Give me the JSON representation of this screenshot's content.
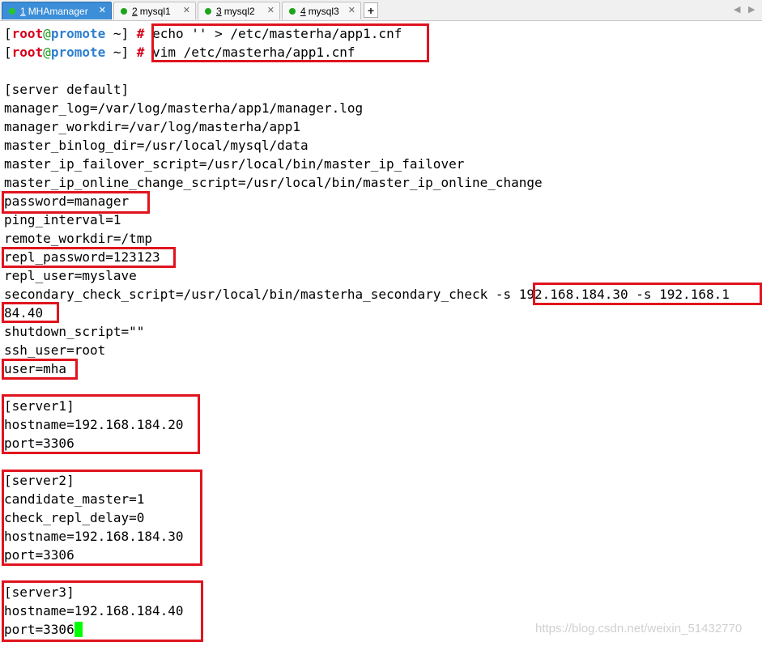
{
  "tabs": [
    {
      "num": "1",
      "label": "MHAmanager",
      "close": "✕"
    },
    {
      "num": "2",
      "label": "mysql1",
      "close": "✕"
    },
    {
      "num": "3",
      "label": "mysql2",
      "close": "✕"
    },
    {
      "num": "4",
      "label": "mysql3",
      "close": "✕"
    }
  ],
  "add_tab": "+",
  "nav": {
    "left": "◀",
    "right": "▶"
  },
  "prompt": {
    "open": "[",
    "user": "root",
    "at": "@",
    "host": "promote",
    "path": " ~]",
    "hash": "#"
  },
  "commands": [
    "echo '' > /etc/masterha/app1.cnf",
    "vim /etc/masterha/app1.cnf"
  ],
  "file_lines": [
    "[server default]",
    "manager_log=/var/log/masterha/app1/manager.log",
    "manager_workdir=/var/log/masterha/app1",
    "master_binlog_dir=/usr/local/mysql/data",
    "master_ip_failover_script=/usr/local/bin/master_ip_failover",
    "master_ip_online_change_script=/usr/local/bin/master_ip_online_change",
    "password=manager",
    "ping_interval=1",
    "remote_workdir=/tmp",
    "repl_password=123123",
    "repl_user=myslave",
    "secondary_check_script=/usr/local/bin/masterha_secondary_check -s 192.168.184.30 -s 192.168.1",
    "84.40",
    "shutdown_script=\"\"",
    "ssh_user=root",
    "user=mha",
    "",
    "[server1]",
    "hostname=192.168.184.20",
    "port=3306",
    "",
    "[server2]",
    "candidate_master=1",
    "check_repl_delay=0",
    "hostname=192.168.184.30",
    "port=3306",
    "",
    "[server3]",
    "hostname=192.168.184.40",
    "port=3306"
  ],
  "watermark": "https://blog.csdn.net/weixin_51432770",
  "colors": {
    "highlight": "#e0141e",
    "cursor": "#00ff00",
    "active_tab": "#3c8ed8",
    "prompt_user": "#d6001c",
    "prompt_host": "#2f7fd0"
  }
}
